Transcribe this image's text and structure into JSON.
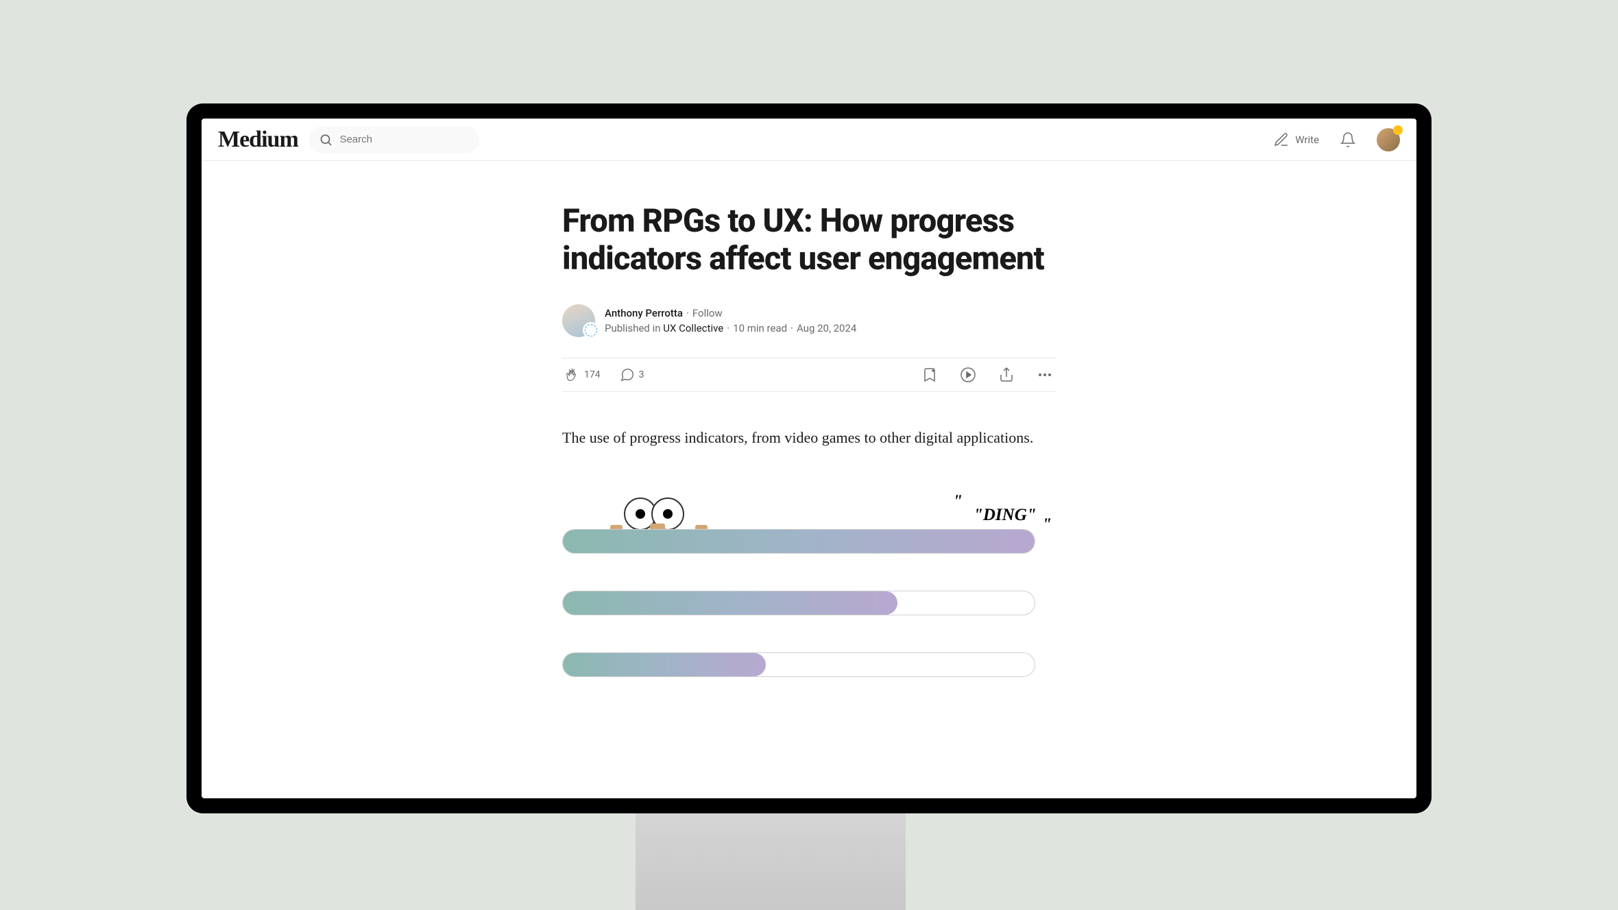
{
  "header": {
    "logo": "Medium",
    "search_placeholder": "Search",
    "write_label": "Write"
  },
  "article": {
    "title": "From RPGs to UX: How progress indicators affect user engagement",
    "author": "Anthony Perrotta",
    "follow_label": "Follow",
    "published_in_label": "Published in",
    "publication": "UX Collective",
    "read_time": "10 min read",
    "date": "Aug 20, 2024",
    "claps": "174",
    "comments": "3",
    "lead": "The use of progress indicators, from video games to other digital applications.",
    "ding": "\"DING\""
  }
}
